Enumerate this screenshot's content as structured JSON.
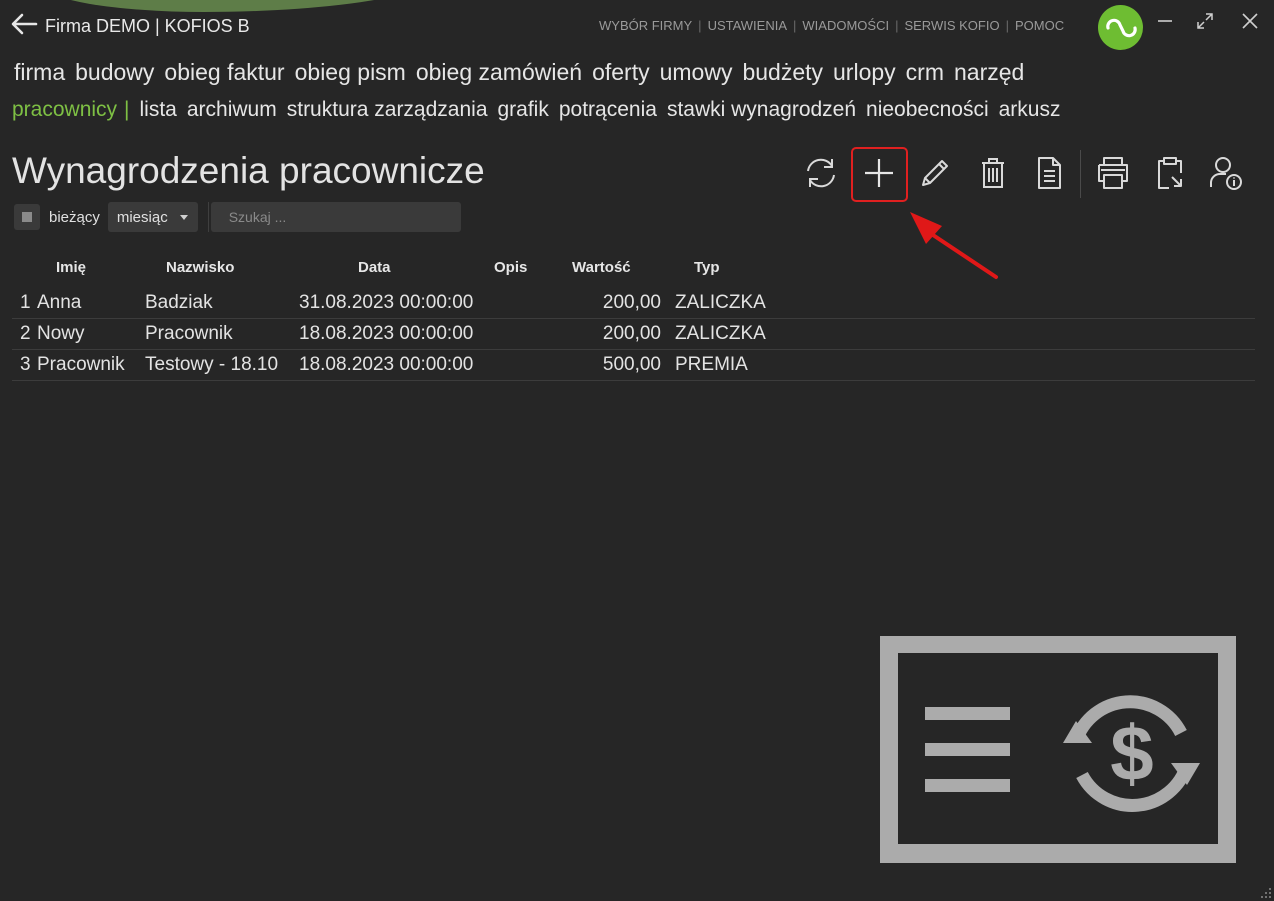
{
  "app": {
    "title": "Firma DEMO | KOFIOS B"
  },
  "top_menu": [
    "WYBÓR FIRMY",
    "USTAWIENIA",
    "WIADOMOŚCI",
    "SERWIS KOFIO",
    "POMOC"
  ],
  "nav_main": [
    "firma",
    "budowy",
    "obieg faktur",
    "obieg pism",
    "obieg zamówień",
    "oferty",
    "umowy",
    "budżety",
    "urlopy",
    "crm",
    "narzęd"
  ],
  "nav_sub": {
    "active": "pracownicy",
    "separator": "|",
    "items": [
      "lista",
      "archiwum",
      "struktura zarządzania",
      "grafik",
      "potrącenia",
      "stawki wynagrodzeń",
      "nieobecności",
      "arkusz"
    ]
  },
  "page": {
    "title": "Wynagrodzenia pracownicze"
  },
  "filters": {
    "current_label": "bieżący",
    "period_value": "miesiąc",
    "search_placeholder": "Szukaj ..."
  },
  "table": {
    "columns": [
      "Imię",
      "Nazwisko",
      "Data",
      "Opis",
      "Wartość",
      "Typ"
    ],
    "rows": [
      {
        "n": "1",
        "imie": "Anna",
        "nazwisko": "Badziak",
        "data": "31.08.2023 00:00:00",
        "opis": "",
        "wartosc": "200,00",
        "typ": "ZALICZKA"
      },
      {
        "n": "2",
        "imie": "Nowy",
        "nazwisko": "Pracownik",
        "data": "18.08.2023 00:00:00",
        "opis": "",
        "wartosc": "200,00",
        "typ": "ZALICZKA"
      },
      {
        "n": "3",
        "imie": "Pracownik",
        "nazwisko": "Testowy - 18.10",
        "data": "18.08.2023 00:00:00",
        "opis": "",
        "wartosc": "500,00",
        "typ": "PREMIA"
      }
    ]
  },
  "colors": {
    "background": "#262626",
    "accent_green": "#7ec044",
    "highlight_red": "#e02020",
    "icon_gray": "#ababab"
  },
  "toolbar_icons": [
    "refresh-icon",
    "add-icon",
    "edit-icon",
    "delete-icon",
    "document-icon",
    "print-icon",
    "clipboard-export-icon",
    "user-info-icon"
  ]
}
